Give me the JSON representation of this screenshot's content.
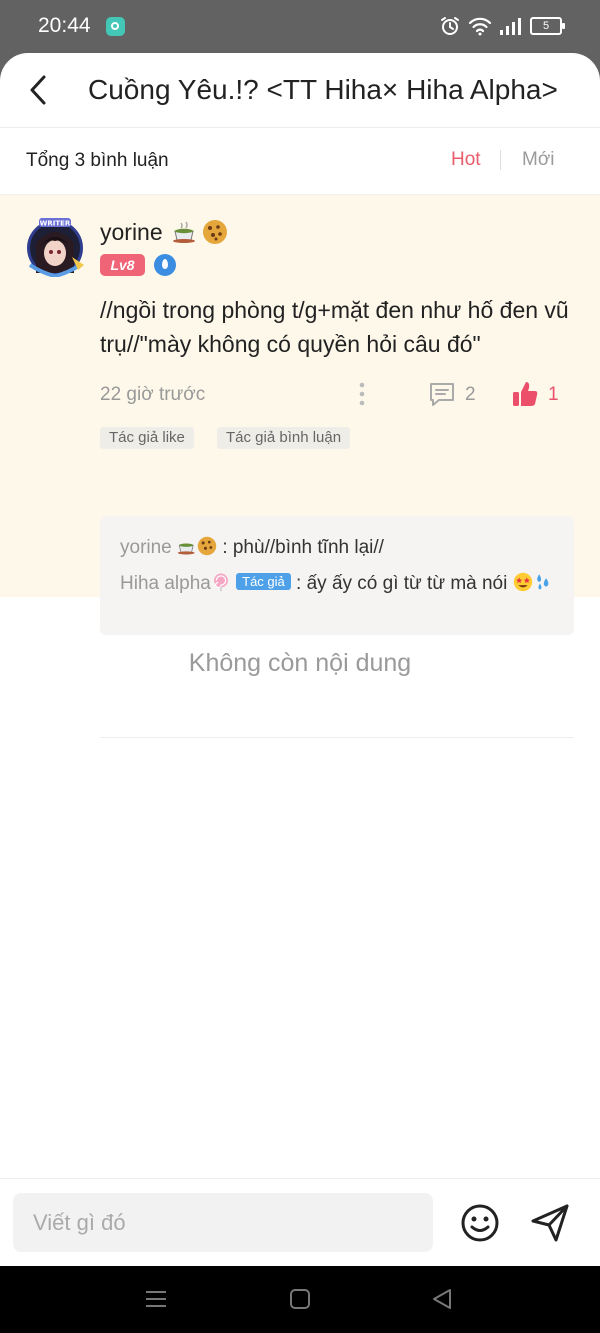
{
  "status_bar": {
    "time": "20:44",
    "battery": "5",
    "icons": [
      "app-notification-icon",
      "alarm-icon",
      "wifi-icon",
      "signal-icon",
      "battery-icon"
    ]
  },
  "header": {
    "title": "Cuồng Yêu.!? <TT Hiha× Hiha Alpha>",
    "back_icon": "chevron-left-icon"
  },
  "summary": {
    "total": "Tổng 3 bình luận",
    "sort_hot": "Hot",
    "sort_new": "Mới"
  },
  "comment": {
    "user": "yorine",
    "level": "Lv8",
    "text": "//ngồi trong phòng t/g+mặt đen như hố đen vũ trụ//\"mày không có quyền hỏi câu đó\"",
    "time": "22 giờ trước",
    "reply_count": "2",
    "like_count": "1",
    "tags": [
      "Tác giả like",
      "Tác giả bình luận"
    ],
    "replies": [
      {
        "user": "yorine",
        "text": ": phù//bình tĩnh lại//"
      },
      {
        "user": "Hiha alpha",
        "badge": "Tác giả",
        "text": ": ấy ấy có gì từ từ mà nói"
      }
    ]
  },
  "empty_text": "Không còn nội dung",
  "input": {
    "placeholder": "Viết gì đó"
  },
  "colors": {
    "accent": "#e95c6b",
    "comment_bg": "#fdf8ea",
    "author_badge": "#4ea1e8",
    "level_badge": "#ef6476"
  }
}
